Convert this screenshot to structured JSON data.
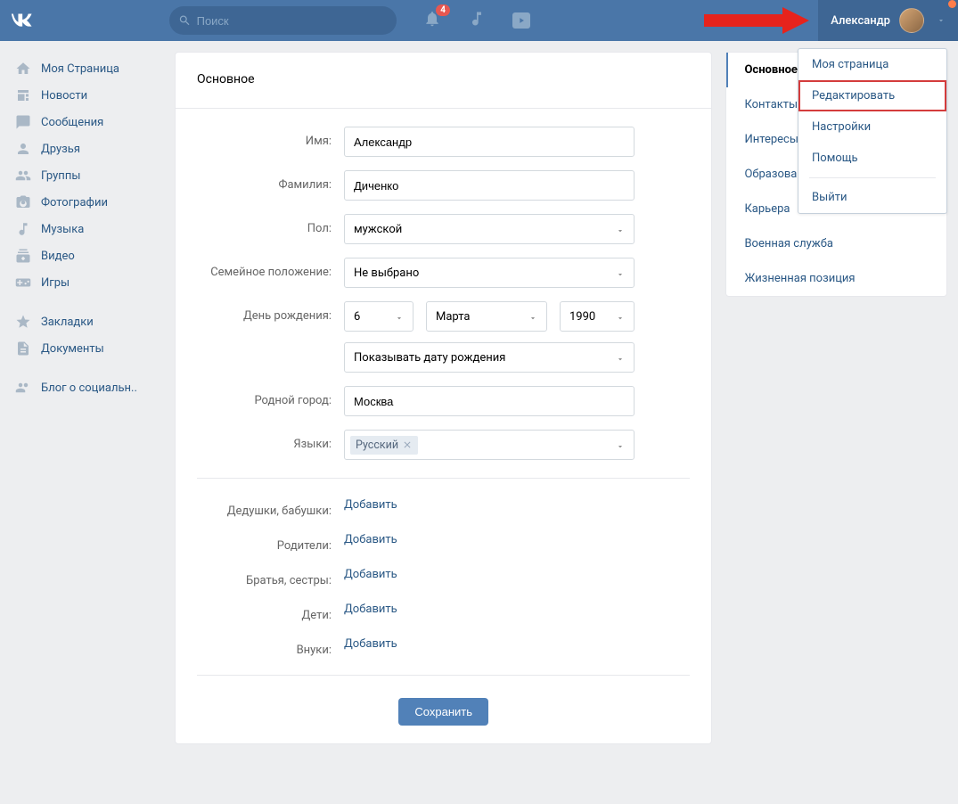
{
  "header": {
    "search_placeholder": "Поиск",
    "noti_count": "4",
    "username": "Александр"
  },
  "sidebar": {
    "items": [
      {
        "label": "Моя Страница",
        "icon": "home"
      },
      {
        "label": "Новости",
        "icon": "news"
      },
      {
        "label": "Сообщения",
        "icon": "messages"
      },
      {
        "label": "Друзья",
        "icon": "friends"
      },
      {
        "label": "Группы",
        "icon": "groups"
      },
      {
        "label": "Фотографии",
        "icon": "photos"
      },
      {
        "label": "Музыка",
        "icon": "music"
      },
      {
        "label": "Видео",
        "icon": "video"
      },
      {
        "label": "Игры",
        "icon": "games"
      }
    ],
    "extra1": [
      {
        "label": "Закладки",
        "icon": "bookmark"
      },
      {
        "label": "Документы",
        "icon": "docs"
      }
    ],
    "extra2": [
      {
        "label": "Блог о социальн..",
        "icon": "blog"
      }
    ]
  },
  "main": {
    "title": "Основное",
    "labels": {
      "first_name": "Имя:",
      "last_name": "Фамилия:",
      "sex": "Пол:",
      "relationship": "Семейное положение:",
      "dob": "День рождения:",
      "dob_visibility": "Показывать дату рождения",
      "hometown": "Родной город:",
      "languages": "Языки:",
      "grandparents": "Дедушки, бабушки:",
      "parents": "Родители:",
      "siblings": "Братья, сестры:",
      "children": "Дети:",
      "grandchildren": "Внуки:"
    },
    "values": {
      "first_name": "Александр",
      "last_name": "Диченко",
      "sex": "мужской",
      "relationship": "Не выбрано",
      "dob_day": "6",
      "dob_month": "Марта",
      "dob_year": "1990",
      "hometown": "Москва",
      "language_token": "Русский"
    },
    "add_link": "Добавить",
    "save": "Сохранить"
  },
  "tabs": {
    "items": [
      "Основное",
      "Контакты",
      "Интересы",
      "Образование",
      "Карьера",
      "Военная служба",
      "Жизненная позиция"
    ]
  },
  "dropdown": {
    "items": [
      "Моя страница",
      "Редактировать",
      "Настройки",
      "Помощь"
    ],
    "logout": "Выйти"
  }
}
